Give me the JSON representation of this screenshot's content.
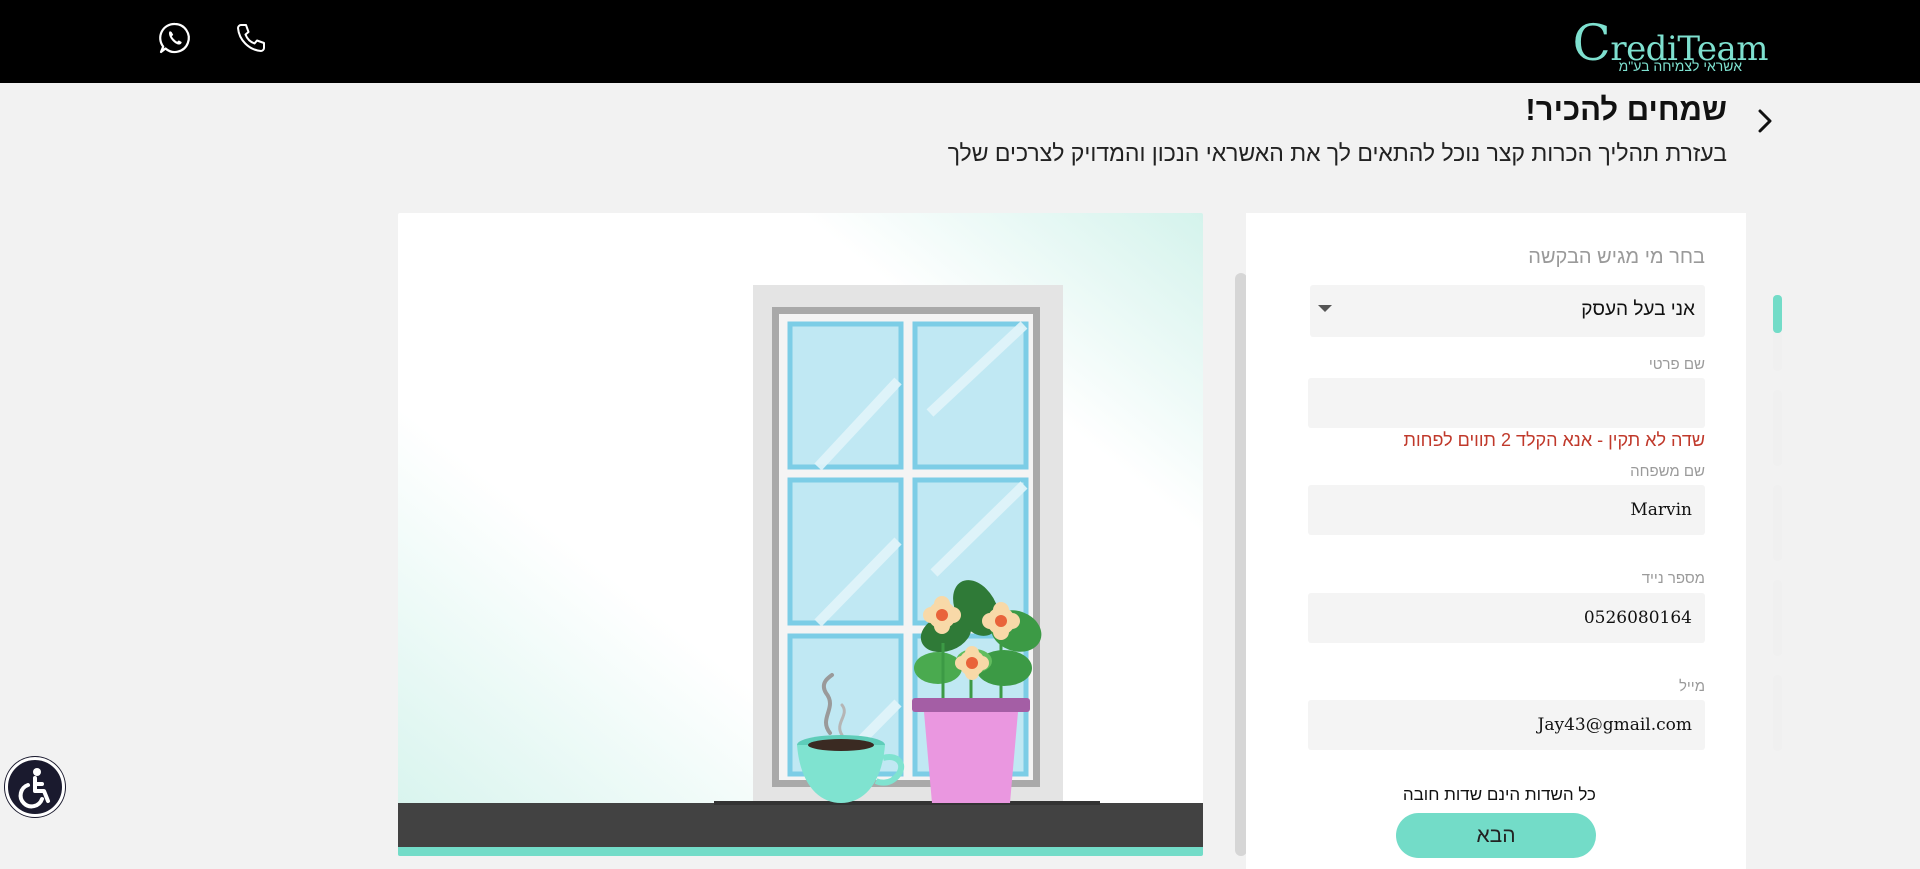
{
  "brand": {
    "logo_text": "CrediTeam",
    "logo_initial": "C",
    "logo_rest": "rediTeam",
    "tagline": "אשראי לצמיחה בע\"מ",
    "accent_color": "#73dcc8"
  },
  "header": {
    "title": "שמחים להכיר!",
    "subtitle": "בעזרת תהליך הכרות קצר נוכל להתאים לך את האשראי הנכון והמדויק לצרכים שלך"
  },
  "top_icons": [
    "whatsapp-icon",
    "phone-icon"
  ],
  "form": {
    "applicant_label": "בחר מי מגיש הבקשה",
    "applicant_value": "אני בעל העסק",
    "first_name": {
      "label": "שם פרטי",
      "value": ""
    },
    "first_name_error": "שדה לא תקין - אנא הקלד 2 תווים לפחות",
    "last_name": {
      "label": "שם משפחה",
      "value": "Marvin"
    },
    "mobile": {
      "label": "מספר נייד",
      "value": "0526080164"
    },
    "email": {
      "label": "מייל",
      "value": "Jay43@gmail.com"
    },
    "required_note": "כל השדות הינם שדות חובה",
    "next_label": "הבא"
  },
  "progress": {
    "total_steps": 5,
    "current_step": 1,
    "current_step_fill": 0.5
  }
}
